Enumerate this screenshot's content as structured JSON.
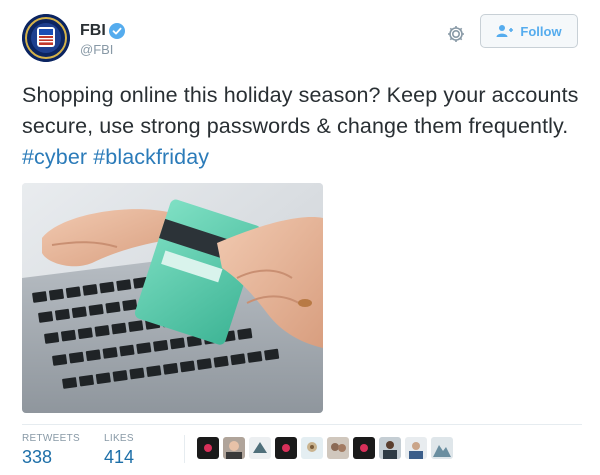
{
  "account": {
    "name": "FBI",
    "handle": "@FBI",
    "verified": true,
    "avatar_icon": "fbi-seal-icon"
  },
  "actions": {
    "settings_icon": "gear-icon",
    "follow_label": "Follow",
    "follow_icon": "add-user-icon"
  },
  "tweet": {
    "text_plain": "Shopping online this holiday season? Keep your accounts secure, use strong passwords & change them frequently.",
    "hashtags": [
      "#cyber",
      "#blackfriday"
    ]
  },
  "stats": {
    "retweets_label": "RETWEETS",
    "retweets_value": "338",
    "likes_label": "LIKES",
    "likes_value": "414"
  },
  "colors": {
    "link": "#2b7bb9",
    "accent": "#55acee",
    "text": "#292f33",
    "muted": "#8899a6"
  }
}
